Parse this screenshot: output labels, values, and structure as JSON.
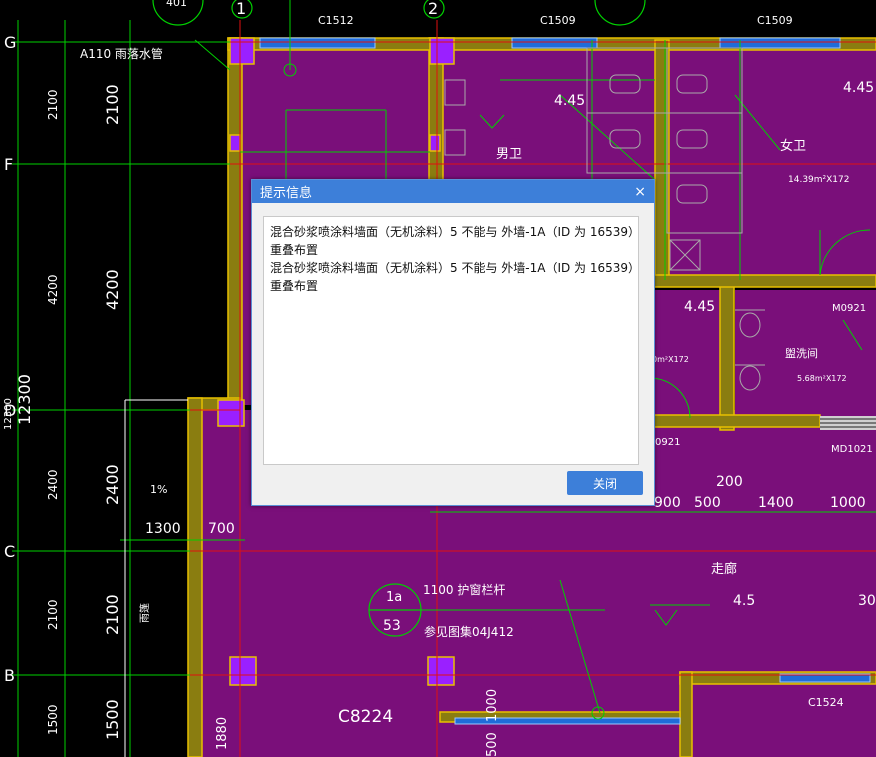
{
  "dialog": {
    "title": "提示信息",
    "close_icon": "×",
    "messages": [
      "混合砂浆喷涂料墙面（无机涂料）5 不能与 外墙-1A（ID 为 16539）",
      "重叠布置",
      "混合砂浆喷涂料墙面（无机涂料）5 不能与 外墙-1A（ID 为 16539）",
      "重叠布置"
    ],
    "close_button": "关闭"
  },
  "cad": {
    "axis_labels": [
      "G",
      "F",
      "D",
      "C",
      "B",
      "1",
      "2"
    ],
    "top_tags": [
      "401",
      "C1512",
      "C1509",
      "C1509"
    ],
    "dims_left_outer": [
      "2100",
      "4200",
      "2400",
      "2100",
      "1500"
    ],
    "dims_left_inner": [
      "2100",
      "4200",
      "2400",
      "2100",
      "1500"
    ],
    "dims_vertical_total": [
      "12300",
      "12300"
    ],
    "dims_row": [
      "1300",
      "700",
      "200",
      "1400",
      "1000",
      "900",
      "500",
      "1880",
      "1000",
      "500"
    ],
    "slope_label": "1%",
    "labels": {
      "a110": "A110 雨落水管",
      "elev_1": "4.45",
      "elev_2": "4.45",
      "elev_3": "4.45",
      "elev_4": "4.5",
      "room_male": "男卫",
      "room_female": "女卫",
      "female_area": "14.39m²X172",
      "m0921_a": "M0921",
      "m0921_b": "0921",
      "washroom": "盥洗间",
      "washroom_area": "5.68m²X172",
      "area_left": "0m²X172",
      "md1021": "MD1021",
      "corridor": "走廊",
      "corridor_num": "30",
      "circle_top": "1a",
      "circle_bottom": "53",
      "railing": "1100 护窗栏杆",
      "ref_standard": "参见图集04J412",
      "c8224": "C8224",
      "c1524": "C1524",
      "stair": "雨篷"
    }
  }
}
